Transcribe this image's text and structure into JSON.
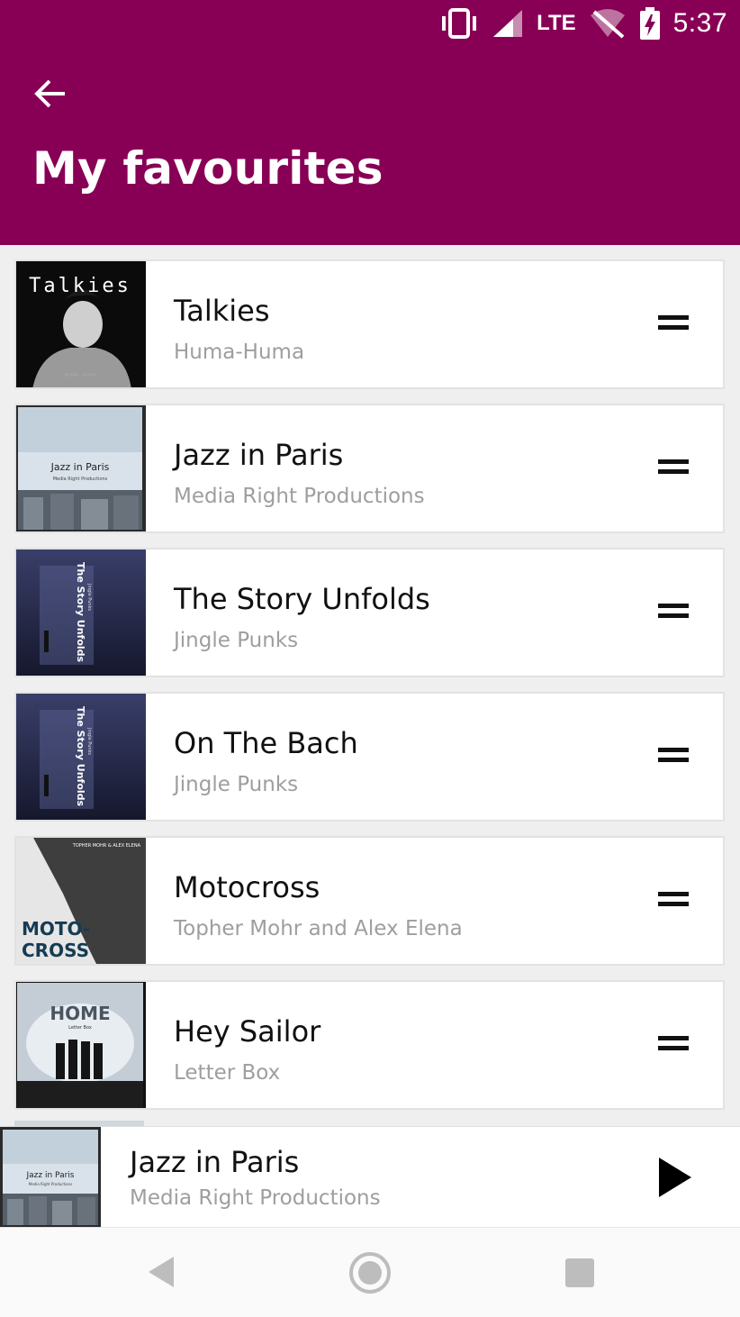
{
  "status_bar": {
    "time": "5:37",
    "network": "LTE",
    "icons": [
      "vibrate-icon",
      "signal-icon",
      "wifi-off-icon",
      "battery-charging-icon"
    ]
  },
  "header": {
    "title": "My favourites",
    "back_icon": "arrow-left-icon",
    "color": "#880055"
  },
  "favourites": [
    {
      "title": "Talkies",
      "artist": "Huma-Huma",
      "cover_text": "Talkies",
      "cover_sub": "HUMA - HUMA"
    },
    {
      "title": "Jazz in Paris",
      "artist": "Media Right Productions",
      "cover_text": "Jazz in Paris",
      "cover_sub": "Media Right Productions"
    },
    {
      "title": "The Story Unfolds",
      "artist": "Jingle Punks",
      "cover_text": "The Story Unfolds",
      "cover_sub": "Jingle Punks"
    },
    {
      "title": "On The Bach",
      "artist": "Jingle Punks",
      "cover_text": "The Story Unfolds",
      "cover_sub": "Jingle Punks"
    },
    {
      "title": "Motocross",
      "artist": "Topher Mohr and Alex Elena",
      "cover_text": "MOTO-",
      "cover_text2": "CROSS",
      "cover_sub": "TOPHER MOHR & ALEX ELENA"
    },
    {
      "title": "Hey Sailor",
      "artist": "Letter Box",
      "cover_text": "HOME",
      "cover_sub": "Letter Box"
    }
  ],
  "now_playing": {
    "title": "Jazz in Paris",
    "artist": "Media Right Productions",
    "cover_text": "Jazz in Paris",
    "cover_sub": "Media Right Productions",
    "action_icon": "play-icon"
  },
  "nav_bar": {
    "icons": [
      "nav-back-icon",
      "nav-home-icon",
      "nav-recents-icon"
    ]
  }
}
